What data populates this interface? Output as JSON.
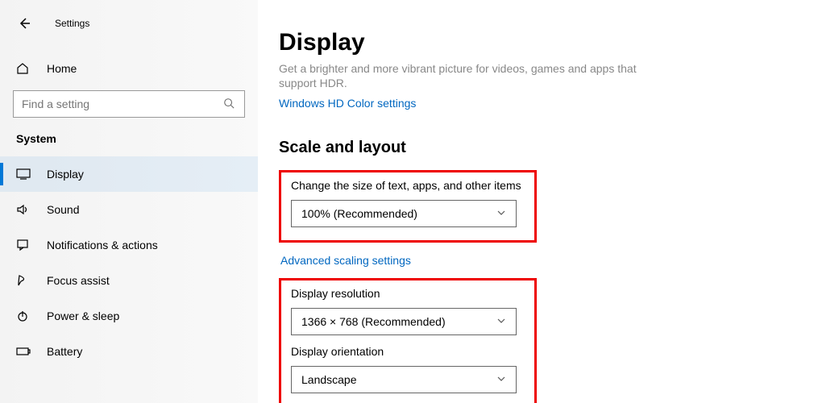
{
  "header": {
    "settings_label": "Settings"
  },
  "sidebar": {
    "home_label": "Home",
    "search_placeholder": "Find a setting",
    "section_label": "System",
    "items": [
      {
        "label": "Display",
        "active": true
      },
      {
        "label": "Sound"
      },
      {
        "label": "Notifications & actions"
      },
      {
        "label": "Focus assist"
      },
      {
        "label": "Power & sleep"
      },
      {
        "label": "Battery"
      }
    ]
  },
  "main": {
    "title": "Display",
    "hdr_desc": "Get a brighter and more vibrant picture for videos, games and apps that support HDR.",
    "hdr_link": "Windows HD Color settings",
    "scale_section_title": "Scale and layout",
    "scale_label": "Change the size of text, apps, and other items",
    "scale_value": "100% (Recommended)",
    "advanced_scaling_link": "Advanced scaling settings",
    "resolution_label": "Display resolution",
    "resolution_value": "1366 × 768 (Recommended)",
    "orientation_label": "Display orientation",
    "orientation_value": "Landscape"
  }
}
